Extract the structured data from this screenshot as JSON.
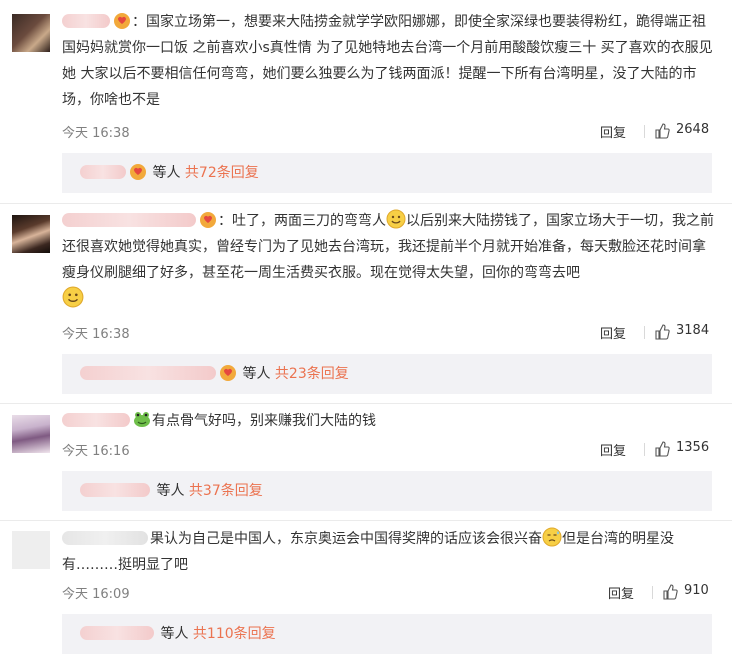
{
  "comments": [
    {
      "text": "：国家立场第一，想要来大陆捞金就学学欧阳娜娜，即使全家深绿也要装得粉红，跪得端正祖国妈妈就赏你一口饭 之前喜欢小s真性情 为了见她特地去台湾一个月前用酸酸饮瘦三十 买了喜欢的衣服见她 大家以后不要相信任何弯弯，她们要么独要么为了钱两面派！提醒一下所有台湾明星，没了大陆的市场，你啥也不是",
      "time": "今天 16:38",
      "reply": "回复",
      "likes": "2648",
      "reply_summary": {
        "who": "等人",
        "more": "共72条回复"
      }
    },
    {
      "text_a": "：吐了，两面三刀的弯弯人",
      "text_b": "以后别来大陆捞钱了，国家立场大于一切，我之前还很喜欢她觉得她真实，曾经专门为了见她去台湾玩，我还提前半个月就开始准备，每天敷脸还花时间拿瘦身仪刷腿细了好多，甚至花一周生活费买衣服。现在觉得太失望，回你的弯弯去吧",
      "time": "今天 16:38",
      "reply": "回复",
      "likes": "3184",
      "reply_summary": {
        "who": "等人",
        "more": "共23条回复"
      }
    },
    {
      "text": "有点骨气好吗，别来赚我们大陆的钱",
      "time": "今天 16:16",
      "reply": "回复",
      "likes": "1356",
      "reply_summary": {
        "who": "等人",
        "more": "共37条回复"
      }
    },
    {
      "text_a": "果认为自己是中国人，东京奥运会中国得奖牌的话应该会很兴奋",
      "text_b": "但是台湾的明星没有………挺明显了吧",
      "time": "今天 16:09",
      "reply": "回复",
      "likes": "910",
      "reply_summary": {
        "who": "等人",
        "more": "共110条回复"
      }
    }
  ],
  "icons": {
    "thumb": "thumbs-up-icon",
    "smile": "smile-emoji",
    "heart_badge": "heart-badge-icon",
    "frog": "frog-emoji",
    "sweat": "sweat-emoji"
  },
  "colors": {
    "accent": "#eb7350",
    "reply_bg": "#f2f2f5",
    "muted": "#808080"
  }
}
